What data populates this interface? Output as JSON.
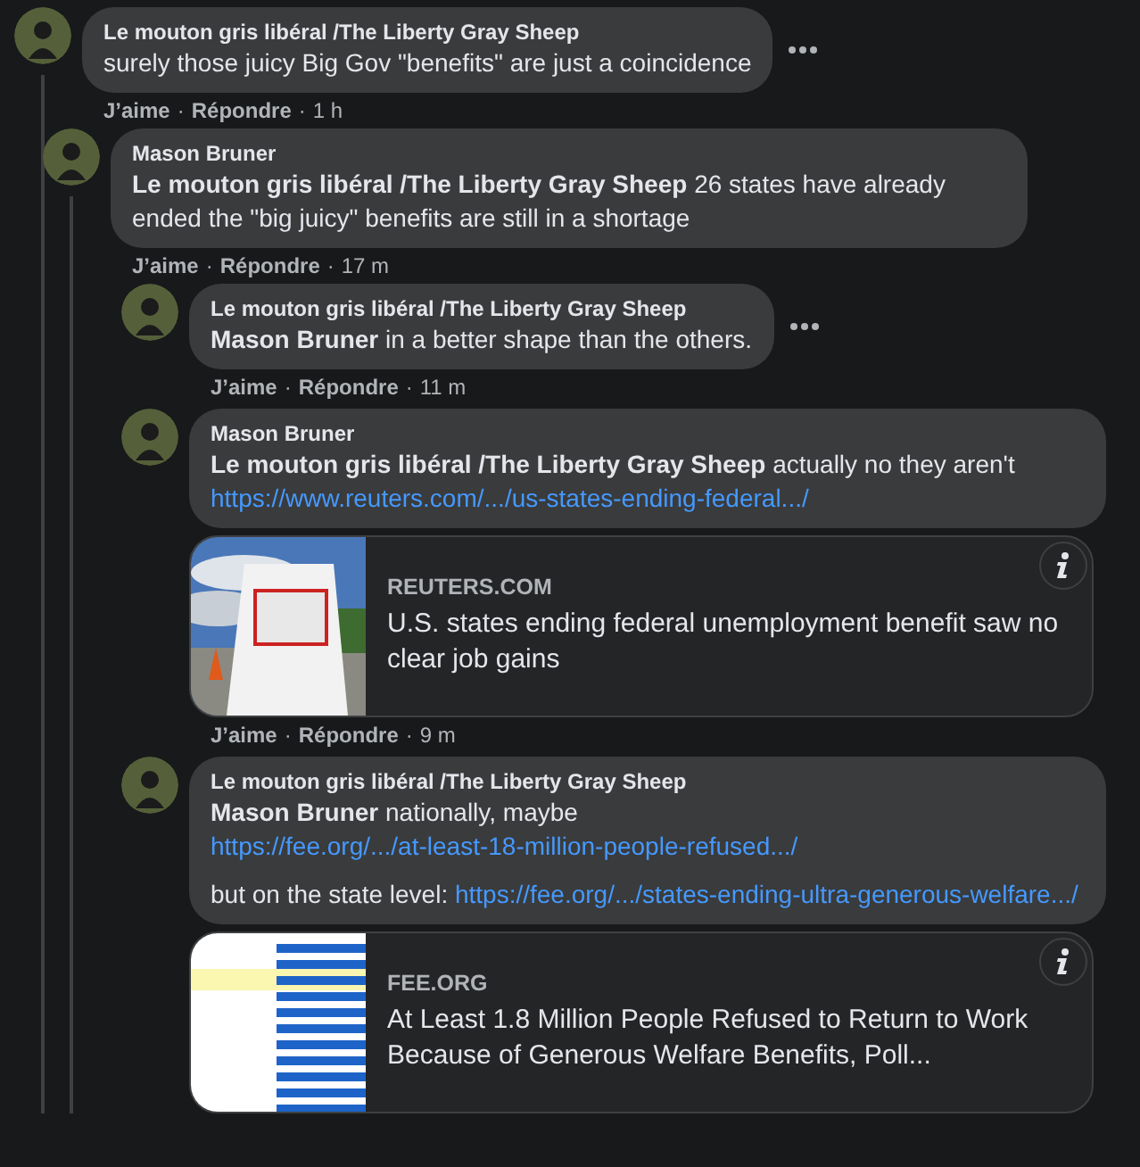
{
  "separator": "·",
  "comments": [
    {
      "author": "Le mouton gris libéral /The Liberty Gray Sheep",
      "more_menu": true,
      "paragraphs": [
        [
          {
            "kind": "text",
            "text": "surely those juicy Big Gov \"benefits\" are just a coincidence"
          }
        ]
      ],
      "actions": [
        "J’aime",
        "Répondre"
      ],
      "time": "1 h",
      "children": [
        {
          "author": "Mason Bruner",
          "more_menu": false,
          "paragraphs": [
            [
              {
                "kind": "text",
                "text": "**Le mouton gris libéral /The Liberty Gray Sheep** 26 states have already ended the \"big juicy\" benefits are still in a shortage"
              }
            ]
          ],
          "actions": [
            "J’aime",
            "Répondre"
          ],
          "time": "17 m",
          "children": [
            {
              "author": "Le mouton gris libéral /The Liberty Gray Sheep",
              "more_menu": true,
              "paragraphs": [
                [
                  {
                    "kind": "text",
                    "text": "**Mason Bruner** in a better shape than the others."
                  }
                ]
              ],
              "actions": [
                "J’aime",
                "Répondre"
              ],
              "time": "11 m"
            },
            {
              "author": "Mason Bruner",
              "more_menu": false,
              "paragraphs": [
                [
                  {
                    "kind": "text",
                    "text": "**Le mouton gris libéral /The Liberty Gray Sheep** actually no they aren't"
                  },
                  {
                    "kind": "link",
                    "text": "https://www.reuters.com/.../us-states-ending-federal.../"
                  }
                ]
              ],
              "preview": {
                "kind": "picture",
                "domain": "REUTERS.COM",
                "title": "U.S. states ending federal unemployment benefit saw no clear job gains"
              },
              "actions": [
                "J’aime",
                "Répondre"
              ],
              "time": "9 m"
            },
            {
              "author": "Le mouton gris libéral /The Liberty Gray Sheep",
              "more_menu": false,
              "paragraphs": [
                [
                  {
                    "kind": "text",
                    "text": "**Mason Bruner** nationally, maybe"
                  },
                  {
                    "kind": "link",
                    "text": "https://fee.org/.../at-least-18-million-people-refused.../"
                  }
                ],
                [
                  {
                    "kind": "text",
                    "text": "but on the state level:"
                  },
                  {
                    "kind": "link",
                    "text": "https://fee.org/.../states-ending-ultra-generous-welfare.../"
                  }
                ]
              ],
              "preview": {
                "kind": "picture",
                "domain": "FEE.ORG",
                "title": "At Least 1.8 Million People Refused to Return to Work Because of Generous Welfare Benefits, Poll..."
              }
            }
          ]
        }
      ]
    }
  ]
}
